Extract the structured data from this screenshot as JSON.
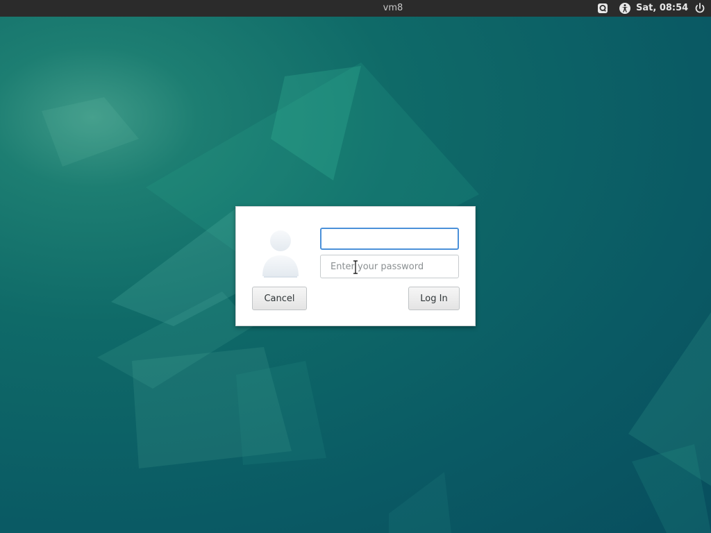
{
  "topbar": {
    "hostname": "vm8",
    "clock": "Sat, 08:54",
    "icons": {
      "keyboard": "keyboard-layout-icon",
      "accessibility": "accessibility-icon",
      "power": "power-icon"
    }
  },
  "login": {
    "avatar_icon": "user-avatar-icon",
    "username_value": "",
    "password_placeholder": "Enter your password",
    "cancel_label": "Cancel",
    "login_label": "Log In"
  },
  "colors": {
    "topbar_bg": "#2b2b2b",
    "desktop_base": "#0a5a64",
    "focus_border": "#4a90d9"
  }
}
